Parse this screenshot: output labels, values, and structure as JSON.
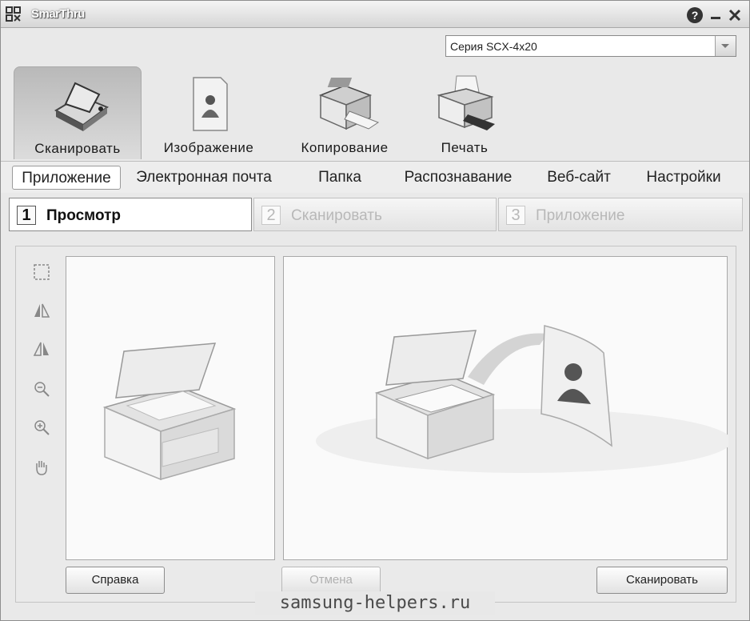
{
  "window": {
    "title": "SmarThru"
  },
  "device": {
    "selected": "Серия SCX-4x20"
  },
  "main_tabs": [
    {
      "label": "Сканировать",
      "icon": "scanner-icon",
      "active": true
    },
    {
      "label": "Изображение",
      "icon": "image-icon",
      "active": false
    },
    {
      "label": "Копирование",
      "icon": "copier-icon",
      "active": false
    },
    {
      "label": "Печать",
      "icon": "printer-icon",
      "active": false
    }
  ],
  "sub_tabs": [
    {
      "label": "Приложение",
      "active": true
    },
    {
      "label": "Электронная почта",
      "active": false
    },
    {
      "label": "Папка",
      "active": false
    },
    {
      "label": "Распознавание",
      "active": false
    },
    {
      "label": "Веб-сайт",
      "active": false
    },
    {
      "label": "Настройки",
      "active": false
    }
  ],
  "steps": [
    {
      "num": "1",
      "label": "Просмотр",
      "state": "active"
    },
    {
      "num": "2",
      "label": "Сканировать",
      "state": "disabled"
    },
    {
      "num": "3",
      "label": "Приложение",
      "state": "disabled"
    }
  ],
  "tools": [
    "select-area-icon",
    "flip-horizontal-icon",
    "flip-vertical-icon",
    "zoom-out-icon",
    "zoom-in-icon",
    "hand-pan-icon"
  ],
  "buttons": {
    "help": "Справка",
    "cancel": "Отмена",
    "scan": "Сканировать"
  },
  "watermark": "samsung-helpers.ru"
}
